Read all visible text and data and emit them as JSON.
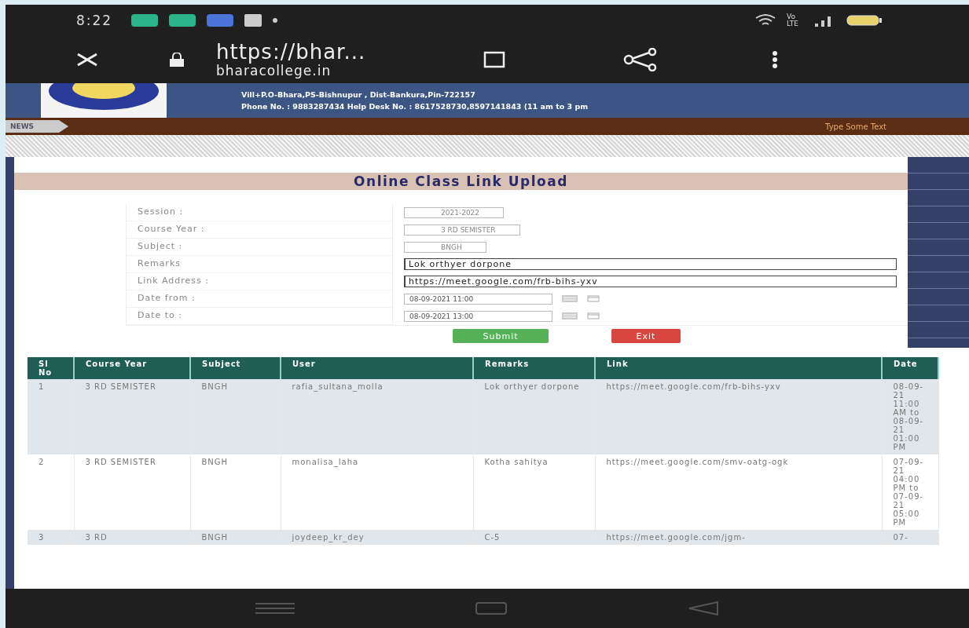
{
  "status_bar": {
    "time": "8:22",
    "network_label": "Vo LTE"
  },
  "browser": {
    "url_title": "https://bhar...",
    "domain": "bharacollege.in"
  },
  "site_header": {
    "address": "Vill+P.O-Bhara,PS-Bishnupur , Dist-Bankura,Pin-722157",
    "phone": "Phone No. : 9883287434   Help Desk No. : 8617528730,8597141843 (11 am to 3 pm"
  },
  "news": {
    "label": "NEWS",
    "ticker": "Type Some Text"
  },
  "form": {
    "title": "Online Class Link Upload",
    "fields": [
      {
        "label": "Session :",
        "kind": "select",
        "value": "2021-2022"
      },
      {
        "label": "Course Year :",
        "kind": "select",
        "value": "3 RD SEMISTER"
      },
      {
        "label": "Subject :",
        "kind": "select",
        "value": "BNGH"
      },
      {
        "label": "Remarks",
        "kind": "text",
        "value": "Lok orthyer dorpone"
      },
      {
        "label": "Link Address :",
        "kind": "text",
        "value": "https://meet.google.com/frb-bihs-yxv"
      },
      {
        "label": "Date from :",
        "kind": "date",
        "value": "08-09-2021 11:00"
      },
      {
        "label": "Date to :",
        "kind": "date",
        "value": "08-09-2021 13:00"
      }
    ],
    "buttons": [
      {
        "label": "Submit",
        "kind": "primary"
      },
      {
        "label": "Exit",
        "kind": "danger"
      }
    ]
  },
  "table": {
    "columns": [
      "Sl No",
      "Course Year",
      "Subject",
      "User",
      "Remarks",
      "Link",
      "Date"
    ],
    "rows": [
      [
        "1",
        "3 RD SEMISTER",
        "BNGH",
        "rafia_sultana_molla",
        "Lok orthyer dorpone",
        "https://meet.google.com/frb-bihs-yxv",
        "08-09-21 11:00 AM to 08-09-21 01:00 PM"
      ],
      [
        "2",
        "3 RD SEMISTER",
        "BNGH",
        "monalisa_laha",
        "Kotha sahitya",
        "https://meet.google.com/smv-oatg-ogk",
        "07-09-21 04:00 PM to 07-09-21 05:00 PM"
      ],
      [
        "3",
        "3 RD",
        "BNGH",
        "joydeep_kr_dey",
        "C-5",
        "https://meet.google.com/jgm-",
        "07-"
      ]
    ]
  }
}
